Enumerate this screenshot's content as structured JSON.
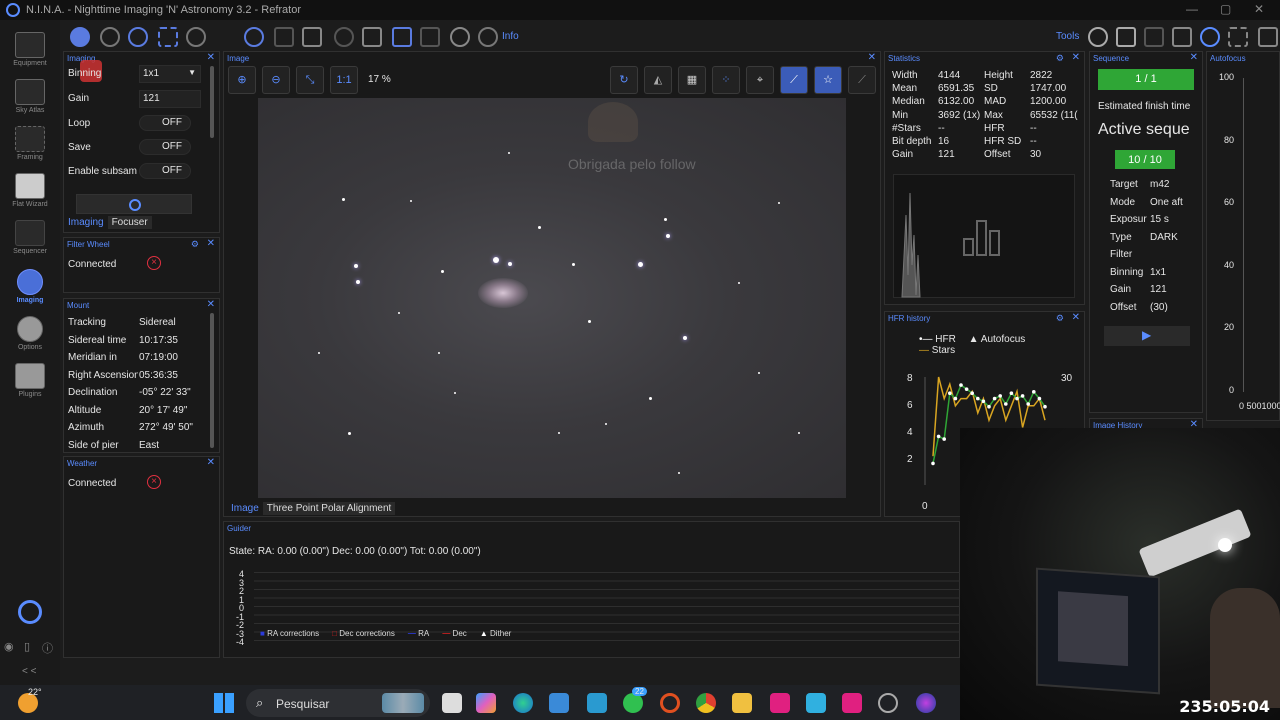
{
  "window": {
    "title": "N.I.N.A. - Nighttime Imaging 'N' Astronomy 3.2   -  Refrator"
  },
  "nav": [
    {
      "label": "Equipment",
      "icon": "camera-icon"
    },
    {
      "label": "Sky Atlas",
      "icon": "atlas-icon"
    },
    {
      "label": "Framing",
      "icon": "framing-icon"
    },
    {
      "label": "Flat Wizard",
      "icon": "flat-icon"
    },
    {
      "label": "Sequencer",
      "icon": "stars-icon"
    },
    {
      "label": "Imaging",
      "icon": "imaging-icon"
    },
    {
      "label": "Options",
      "icon": "gear-icon"
    },
    {
      "label": "Plugins",
      "icon": "puzzle-icon"
    }
  ],
  "nav_collapse": "< <",
  "toolbar": {
    "tools_label": "Tools",
    "info_label": "Info"
  },
  "imaging_panel": {
    "header": "Imaging",
    "binning_label": "Binning",
    "binning_value": "1x1",
    "gain_label": "Gain",
    "gain_value": "121",
    "loop_label": "Loop",
    "loop_value": "OFF",
    "save_label": "Save",
    "save_value": "OFF",
    "subsample_label": "Enable subsam",
    "subsample_value": "OFF",
    "tabs": [
      "Imaging",
      "Focuser"
    ]
  },
  "filter_wheel": {
    "header": "Filter Wheel",
    "status": "Connected"
  },
  "mount": {
    "header": "Mount",
    "rows": [
      {
        "label": "Tracking",
        "value": "Sidereal"
      },
      {
        "label": "Sidereal time",
        "value": "10:17:35"
      },
      {
        "label": "Meridian in",
        "value": "07:19:00"
      },
      {
        "label": "Right Ascension",
        "value": "05:36:35"
      },
      {
        "label": "Declination",
        "value": "-05° 22' 33\""
      },
      {
        "label": "Altitude",
        "value": "20° 17' 49\""
      },
      {
        "label": "Azimuth",
        "value": "272° 49' 50\""
      },
      {
        "label": "Side of pier",
        "value": "East"
      }
    ]
  },
  "weather": {
    "header": "Weather",
    "status": "Connected"
  },
  "image_panel": {
    "header": "Image",
    "zoom": "17 %",
    "one_to_one": "1:1",
    "overlay_text": "Obrigada pelo follow",
    "tabs": [
      "Image",
      "Three Point Polar Alignment"
    ]
  },
  "statistics": {
    "header": "Statistics",
    "rows": [
      {
        "l1": "Width",
        "v1": "4144",
        "l2": "Height",
        "v2": "2822"
      },
      {
        "l1": "Mean",
        "v1": "6591.35",
        "l2": "SD",
        "v2": "1747.00"
      },
      {
        "l1": "Median",
        "v1": "6132.00",
        "l2": "MAD",
        "v2": "1200.00"
      },
      {
        "l1": "Min",
        "v1": "3692 (1x)",
        "l2": "Max",
        "v2": "65532 (11("
      },
      {
        "l1": "#Stars",
        "v1": "--",
        "l2": "HFR",
        "v2": "--"
      },
      {
        "l1": "Bit depth",
        "v1": "16",
        "l2": "HFR SD",
        "v2": "--"
      },
      {
        "l1": "Gain",
        "v1": "121",
        "l2": "Offset",
        "v2": "30"
      }
    ]
  },
  "hfr_history": {
    "header": "HFR history",
    "legend": [
      "HFR",
      "Autofocus",
      "Stars"
    ],
    "y_left_ticks": [
      "8",
      "6",
      "4",
      "2"
    ],
    "y_right_ticks": [
      "30",
      "20"
    ],
    "x_tick": "0"
  },
  "chart_data": {
    "type": "line",
    "title": "",
    "series": [
      {
        "name": "HFR",
        "values": [
          1.6,
          3.6,
          3.4,
          6.8,
          6.4,
          7.4,
          7.1,
          6.8,
          6.4,
          6.2,
          5.8,
          6.4,
          6.6,
          6.0,
          6.8,
          6.4,
          6.6,
          6.0,
          6.9,
          6.4,
          5.8
        ]
      },
      {
        "name": "Stars",
        "values": [
          19,
          30,
          27,
          29,
          26,
          27,
          27,
          28,
          25,
          27,
          24,
          26,
          27,
          24,
          26,
          28,
          23,
          26,
          26,
          27,
          24
        ]
      }
    ],
    "ylim_left": [
      0,
      8
    ],
    "ylim_right": [
      15,
      30
    ]
  },
  "sequence": {
    "header": "Sequence",
    "progress_top": "1 / 1",
    "finish_label": "Estimated finish time",
    "active_title": "Active seque",
    "progress_inner": "10 / 10",
    "rows": [
      {
        "label": "Target",
        "value": "m42"
      },
      {
        "label": "Mode",
        "value": "One aft"
      },
      {
        "label": "Exposur",
        "value": "15 s"
      },
      {
        "label": "Type",
        "value": "DARK"
      },
      {
        "label": "Filter",
        "value": ""
      },
      {
        "label": "Binning",
        "value": "1x1"
      },
      {
        "label": "Gain",
        "value": "121"
      },
      {
        "label": "Offset",
        "value": "(30)"
      }
    ],
    "image_history": "Image History"
  },
  "autofocus": {
    "header": "Autofocus",
    "y_ticks": [
      "100",
      "80",
      "60",
      "40",
      "20",
      "0"
    ],
    "x_ticks": "0 5001000"
  },
  "guider": {
    "header": "Guider",
    "state": "State:  RA: 0.00 (0.00\")  Dec: 0.00 (0.00\")  Tot: 0.00 (0.00\")",
    "y_ticks": [
      "4",
      "3",
      "2",
      "1",
      "0",
      "-1",
      "-2",
      "-3",
      "-4"
    ],
    "legend": [
      "RA corrections",
      "Dec corrections",
      "RA",
      "Dec",
      "Dither"
    ]
  },
  "taskbar": {
    "weather": "22°",
    "search": "Pesquisar",
    "badge": "22"
  },
  "webcam": {
    "timer": "235:05:04"
  },
  "colors": {
    "accent": "#5a8cff",
    "green": "#2fa636",
    "hfr": "#ffffff",
    "stars": "#d9a521",
    "error": "#e03040"
  }
}
